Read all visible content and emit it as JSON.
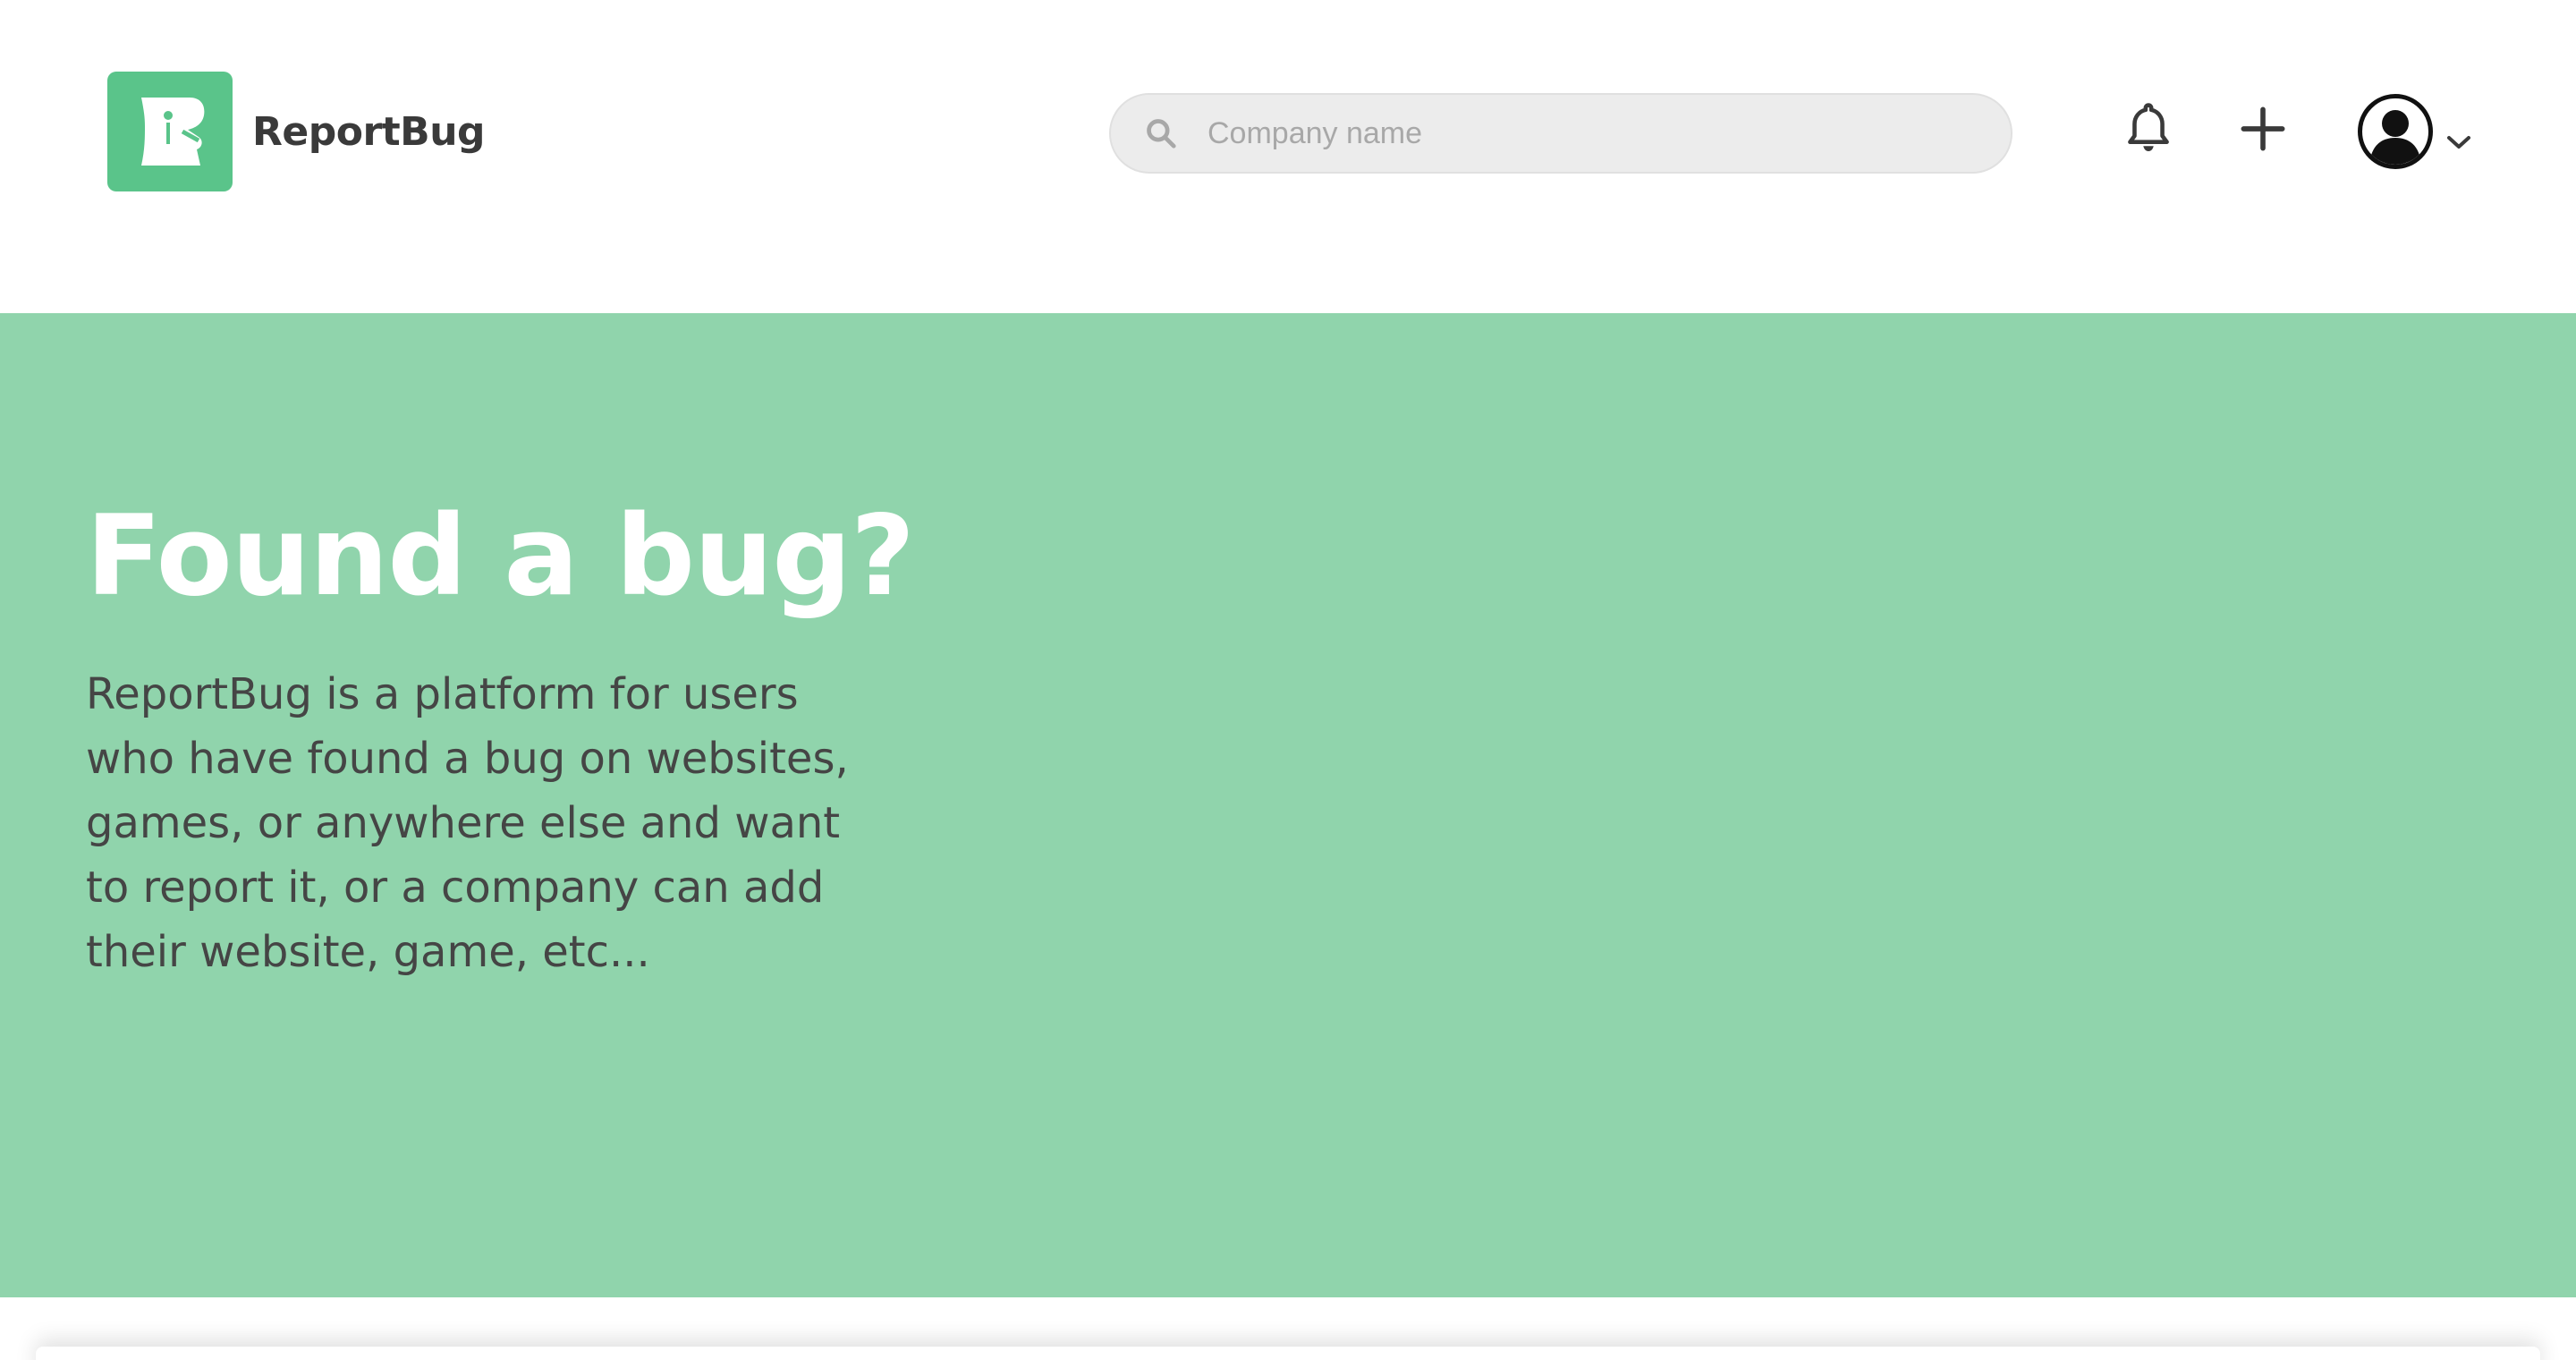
{
  "header": {
    "brand_name": "ReportBug",
    "search": {
      "placeholder": "Company name",
      "value": ""
    },
    "icons": {
      "notifications": "bell-icon",
      "create": "plus-icon",
      "account": "user-avatar-icon",
      "account_menu": "chevron-down-icon"
    }
  },
  "hero": {
    "title": "Found a bug?",
    "description": "ReportBug is a platform for users who have found a bug on websites, games, or anywhere else and want to report it, or a company can add their website, game, etc..."
  },
  "colors": {
    "brand_green": "#5ac48a",
    "hero_background": "#90d4ac",
    "hero_title": "#ffffff",
    "hero_text": "#454545",
    "logo_text": "#3a3a3a"
  }
}
